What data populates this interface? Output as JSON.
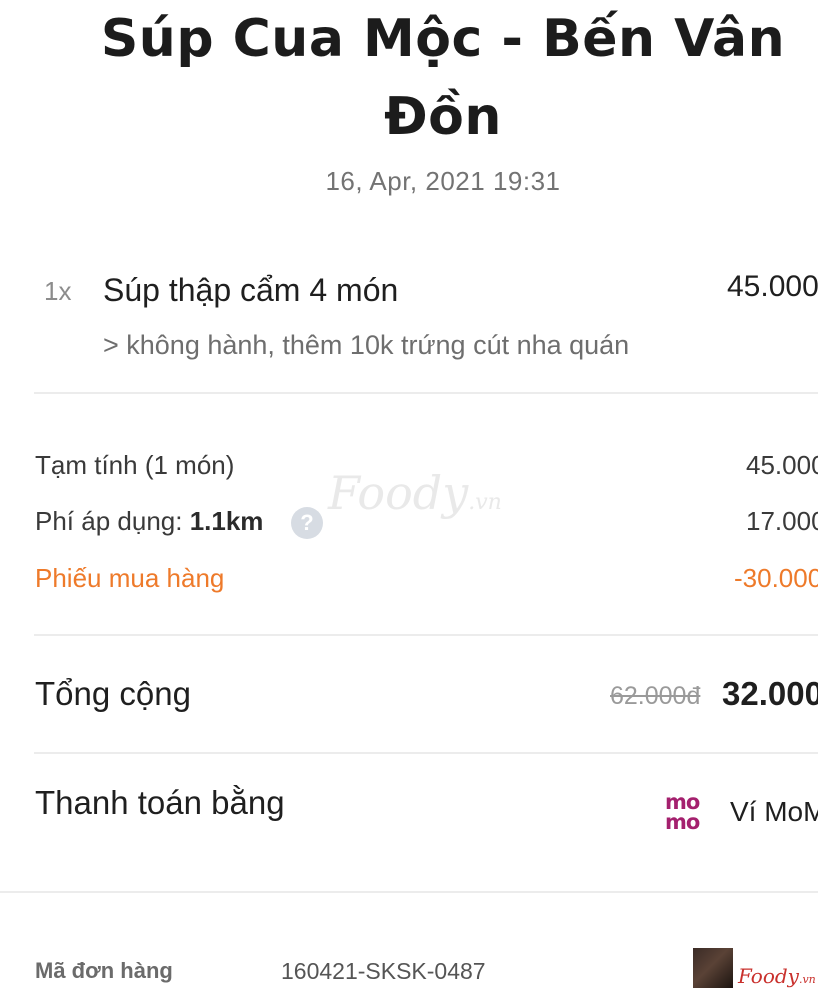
{
  "header": {
    "title_line1": "Súp Cua Mộc - Bến Vân",
    "title_line2": "Đồn",
    "date": "16, Apr, 2021 19:31"
  },
  "order_item": {
    "quantity": "1x",
    "name": "Súp thập cẩm 4 món",
    "price": "45.000",
    "note": "> không hành, thêm 10k trứng cút nha quán"
  },
  "summary": {
    "subtotal_label": "Tạm tính  (1 món)",
    "subtotal_value": "45.000",
    "fee_label": "Phí áp dụng:",
    "fee_distance": "1.1km",
    "fee_help_icon": "question-circle-icon",
    "fee_value": "17.000",
    "voucher_label": "Phiếu mua hàng",
    "voucher_value": "-30.000",
    "voucher_color": "#ee7a2a"
  },
  "watermark": {
    "brand": "Foody",
    "suffix": ".vn"
  },
  "total": {
    "label": "Tổng cộng",
    "original": "62.000đ",
    "final": "32.000"
  },
  "payment": {
    "label": "Thanh toán bằng",
    "logo_line1": "mo",
    "logo_line2": "mo",
    "method": "Ví MoMo",
    "brand_color": "#a4206e"
  },
  "order": {
    "code_label": "Mã đơn hàng",
    "code_value": "160421-SKSK-0487"
  },
  "corner_logo": {
    "brand": "Foody",
    "suffix": ".vn"
  }
}
